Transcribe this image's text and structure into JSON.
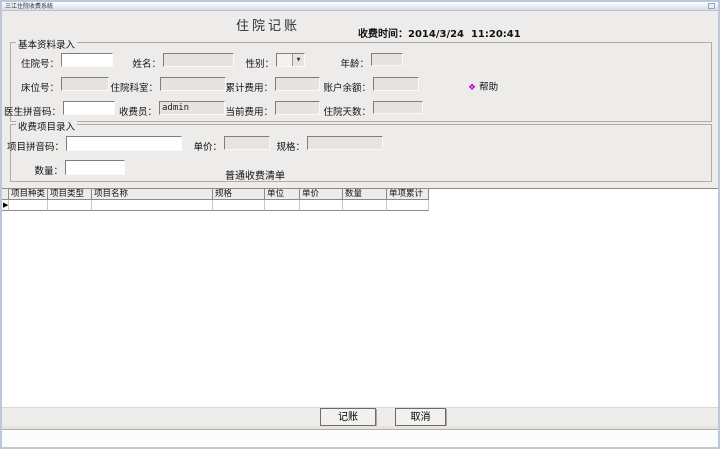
{
  "window": {
    "title": "三江住院收费系统"
  },
  "header": {
    "page_title": "住院记账",
    "time_label": "收费时间：",
    "time_value": "2014/3/24  11:20:41"
  },
  "basic": {
    "legend": "基本资料录入",
    "labels": {
      "admission_no": "住院号：",
      "name": "姓名：",
      "gender": "性别：",
      "age": "年龄：",
      "bed_no": "床位号：",
      "department": "住院科室：",
      "total_fee": "累计费用：",
      "balance": "账户余额：",
      "doctor_pinyin": "医生拼音码：",
      "cashier": "收费员：",
      "current_fee": "当前费用：",
      "days": "住院天数："
    },
    "values": {
      "cashier": "admin"
    },
    "help": "帮助"
  },
  "items": {
    "legend": "收费项目录入",
    "labels": {
      "item_pinyin": "项目拼音码：",
      "unit_price": "单价：",
      "spec": "规格：",
      "quantity": "数量："
    }
  },
  "grid": {
    "caption": "普通收费清单",
    "columns": [
      "项目种类",
      "项目类型",
      "项目名称",
      "规格",
      "单位",
      "单价",
      "数量",
      "单项累计"
    ]
  },
  "buttons": {
    "post": "记账",
    "cancel": "取消"
  },
  "icons": {
    "help": "❖",
    "dropdown": "▼",
    "row_marker": "▶"
  },
  "colors": {
    "help_icon": "#c400b8",
    "form_bg": "#eeeceb",
    "titlebar": "#d6dde8"
  }
}
